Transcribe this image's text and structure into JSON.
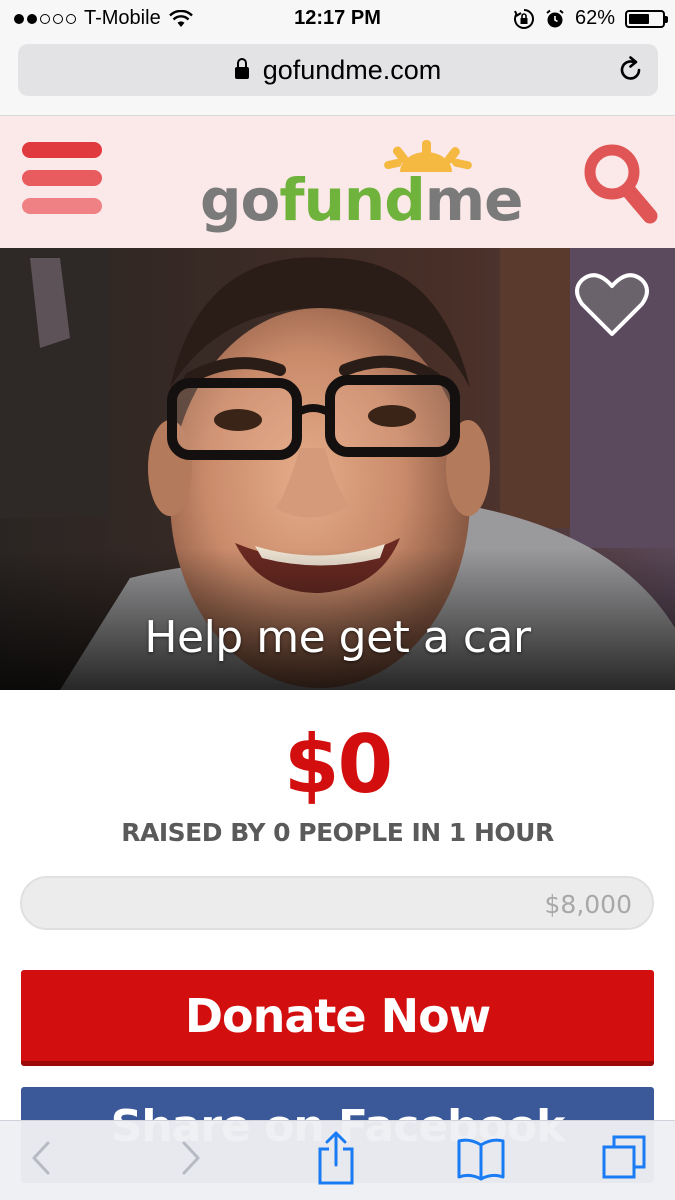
{
  "status_bar": {
    "carrier": "T-Mobile",
    "time": "12:17 PM",
    "battery_percent": "62%",
    "battery_level": 0.62,
    "signal_bars": [
      true,
      true,
      false,
      false,
      false
    ]
  },
  "browser": {
    "url": "gofundme.com"
  },
  "site_header": {
    "logo": {
      "go": "go",
      "fund": "fund",
      "me": "me"
    },
    "menu_colors": [
      "#e0393e",
      "#e85b5e",
      "#ef8185"
    ],
    "accent": "#e05555"
  },
  "campaign": {
    "title": "Help me get a car",
    "raised": "$0",
    "raised_fraction": 0,
    "raised_summary": "RAISED BY 0 PEOPLE IN 1 HOUR",
    "goal": "$8,000"
  },
  "actions": {
    "donate_label": "Donate Now",
    "share_label": "Share on Facebook"
  },
  "colors": {
    "primary_red": "#d20e0e",
    "facebook_blue": "#3b5998",
    "gofundme_green": "#6fb33c",
    "toolbar_blue": "#1a7cf5"
  }
}
